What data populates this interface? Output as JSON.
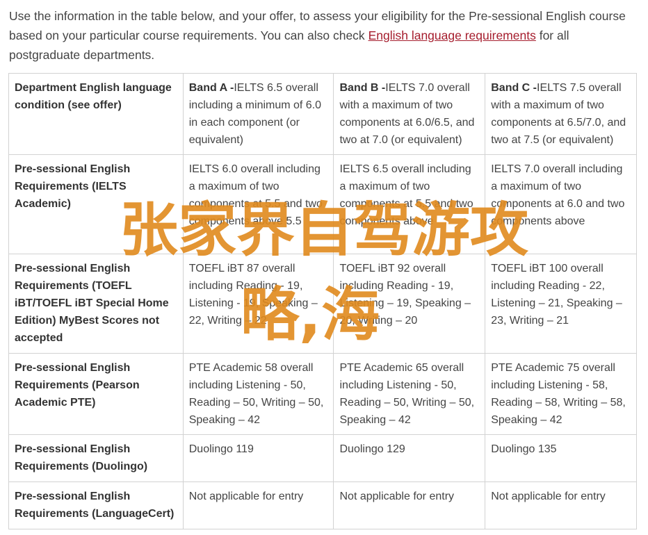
{
  "intro": {
    "text_before": "Use the information in the table below, and your offer, to assess your eligibility for the Pre-sessional English course based on your particular course requirements. You can also check ",
    "link_text": "English language requirements",
    "text_after": " for all postgraduate departments."
  },
  "table": {
    "header": {
      "col1": "Department English language condition (see offer)",
      "bandA_label": "Band A -",
      "bandA_text": "IELTS 6.5 overall including a minimum of 6.0 in each component (or equivalent)",
      "bandB_label": "Band B -",
      "bandB_text": "IELTS 7.0 overall with a maximum of two components at 6.0/6.5, and two at 7.0 (or equivalent)",
      "bandC_label": "Band C -",
      "bandC_text": "IELTS 7.5 overall with a maximum of two components at 6.5/7.0, and two at 7.5 (or equivalent)"
    },
    "rows": [
      {
        "label": "Pre-sessional English Requirements (IELTS Academic)",
        "a": "IELTS 6.0 overall including a maximum of two components at 5.5 and two components above 5.5",
        "b": "IELTS 6.5 overall including a maximum of two components at 5.5 and two components above",
        "c": "IELTS 7.0 overall including a maximum of two components at 6.0 and two components above"
      },
      {
        "label": "Pre-sessional English Requirements (TOEFL iBT/TOEFL iBT Special Home Edition) MyBest Scores not accepted",
        "a": "TOEFL iBT 87 overall including Reading - 19, Listening - 19, Speaking – 22, Writing – 22",
        "b": "TOEFL iBT 92 overall including Reading - 19, Listening – 19, Speaking – 20, Writing – 20",
        "c": "TOEFL iBT 100 overall including Reading - 22, Listening – 21, Speaking – 23, Writing – 21"
      },
      {
        "label": "Pre-sessional English Requirements (Pearson Academic PTE)",
        "a": "PTE Academic 58 overall including Listening - 50, Reading – 50, Writing – 50, Speaking – 42",
        "b": "PTE Academic 65 overall including Listening - 50, Reading – 50, Writing – 50, Speaking – 42",
        "c": "PTE Academic 75 overall including Listening - 58, Reading – 58, Writing – 58, Speaking – 42"
      },
      {
        "label": "Pre-sessional English Requirements (Duolingo)",
        "a": "Duolingo 119",
        "b": "Duolingo 129",
        "c": "Duolingo 135"
      },
      {
        "label": "Pre-sessional English Requirements (LanguageCert)",
        "a": "Not applicable for entry",
        "b": "Not applicable for entry",
        "c": "Not applicable for entry"
      }
    ]
  },
  "watermark": {
    "line1": "张家界自驾游攻",
    "line2": "略,海",
    "color": "#e08a1e"
  },
  "colors": {
    "link": "#a51d2d",
    "border": "#d2d2d2",
    "text": "#444444"
  }
}
